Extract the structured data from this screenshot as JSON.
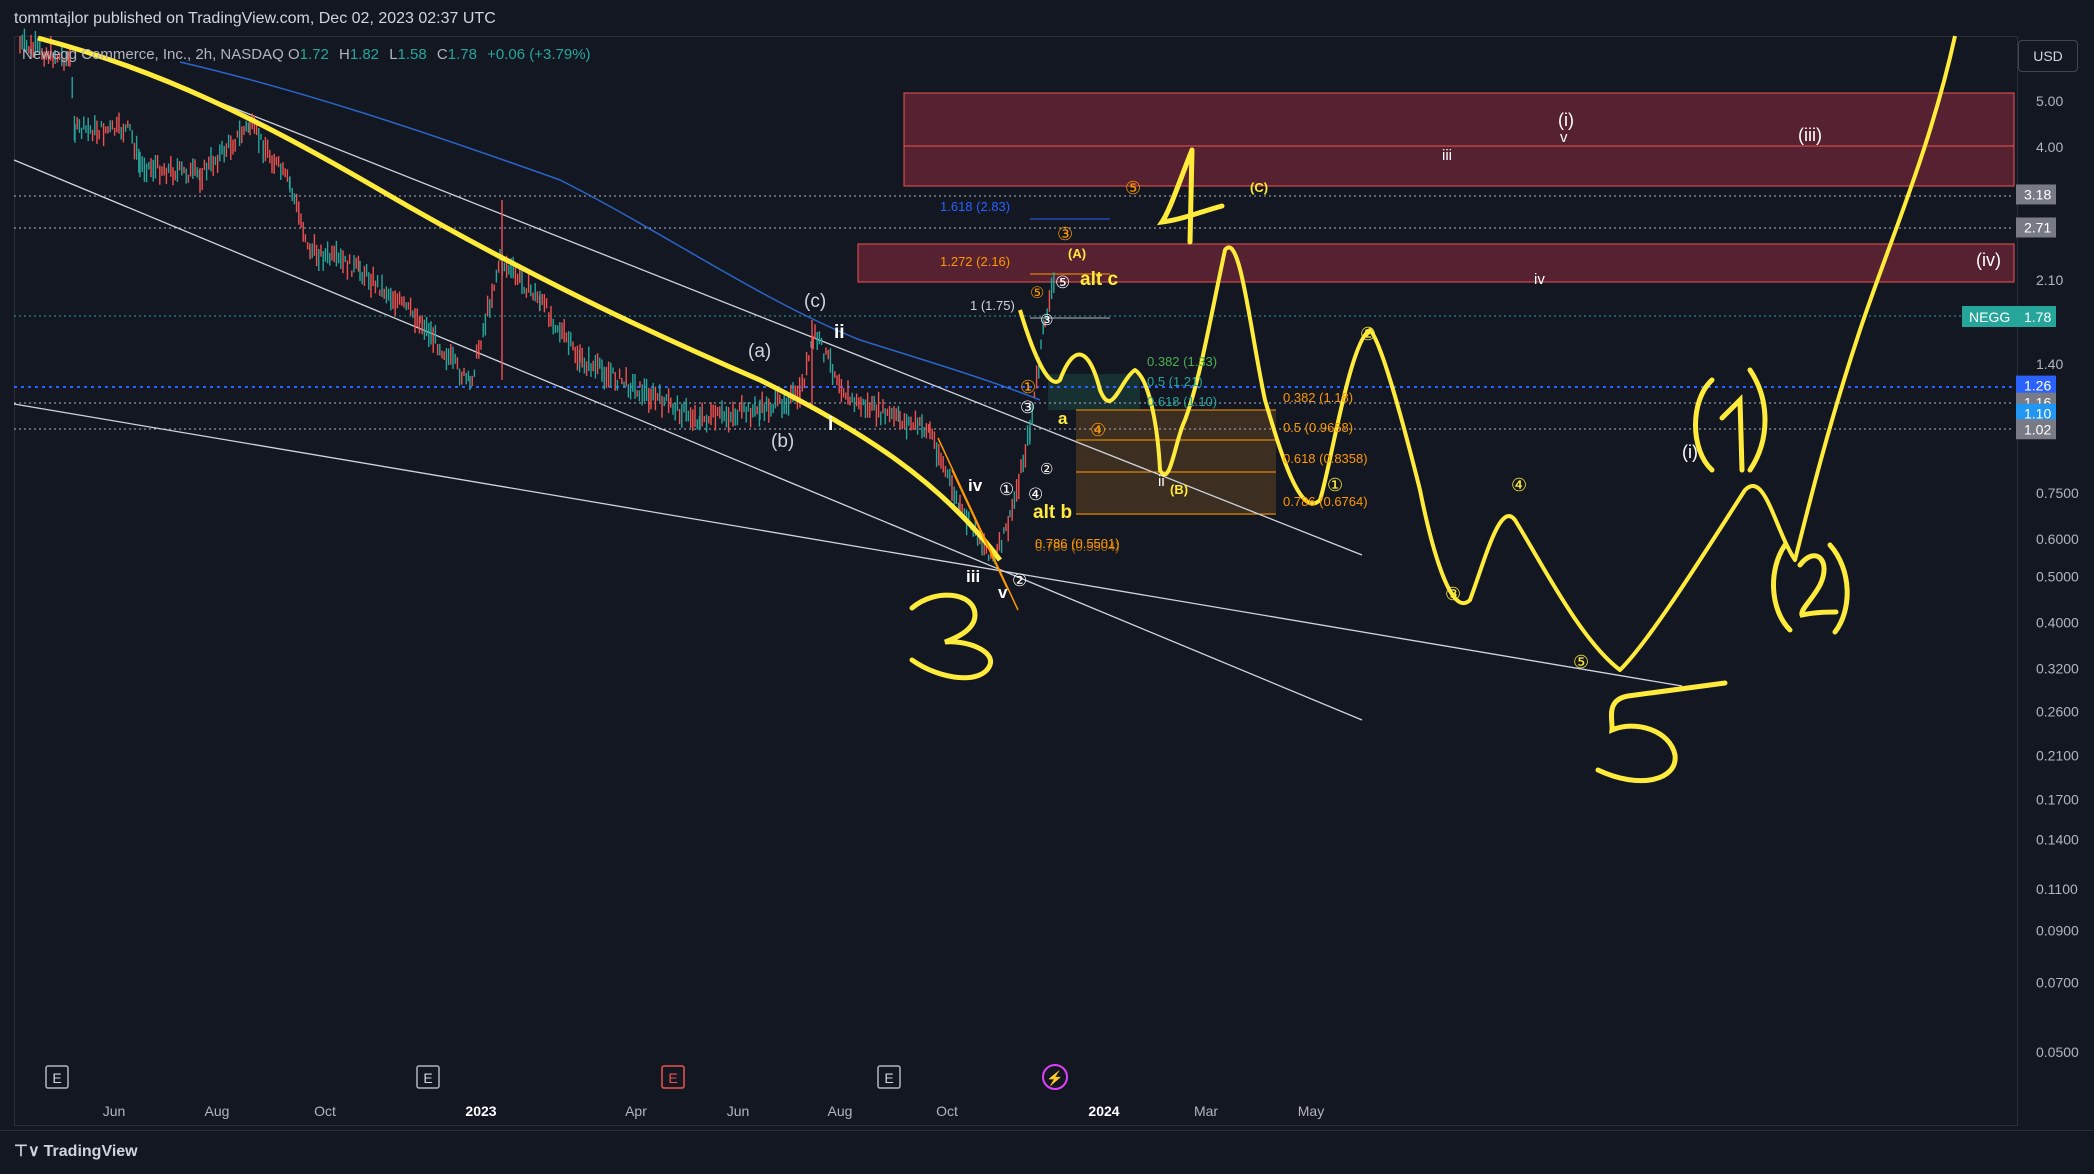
{
  "header": {
    "published_by": "tommtajlor published on TradingView.com, Dec 02, 2023 02:37 UTC"
  },
  "legend": {
    "symbol": "Newegg Commerce, Inc., 2h, NASDAQ",
    "open_label": "O",
    "open": "1.72",
    "high_label": "H",
    "high": "1.82",
    "low_label": "L",
    "low": "1.58",
    "close_label": "C",
    "close": "1.78",
    "change": "+0.06 (+3.79%)"
  },
  "currency": "USD",
  "footer": {
    "brand": "TradingView"
  },
  "colors": {
    "background": "#131722",
    "up": "#26a69a",
    "down": "#ef5350",
    "drawing": "#ffeb3b",
    "zone": "#8e2a3e",
    "blue_line": "#2962ff",
    "ma": "#3179f5"
  },
  "chart_data": {
    "type": "line",
    "title": "Newegg Commerce, Inc., 2h, NASDAQ",
    "y_scale": "log",
    "ylim": [
      0.045,
      6.0
    ],
    "x_ticks": [
      "Jun",
      "Aug",
      "Oct",
      "2023",
      "Apr",
      "Jun",
      "Aug",
      "Oct",
      "2024",
      "Mar",
      "May"
    ],
    "y_ticks": [
      "5.00",
      "4.00",
      "2.10",
      "1.40",
      "0.7500",
      "0.6000",
      "0.5000",
      "0.4000",
      "0.3200",
      "0.2600",
      "0.2100",
      "0.1700",
      "0.1400",
      "0.1100",
      "0.0900",
      "0.0700",
      "0.0500"
    ],
    "price_badges": [
      {
        "label": "3.18",
        "value": 3.18,
        "color": "#787b86"
      },
      {
        "label": "2.71",
        "value": 2.71,
        "color": "#787b86"
      },
      {
        "label": "1.26",
        "value": 1.26,
        "color": "#2962ff"
      },
      {
        "label": "1.16",
        "value": 1.16,
        "color": "#787b86"
      },
      {
        "label": "1.10",
        "value": 1.1,
        "color": "#2196f3"
      },
      {
        "label": "1.02",
        "value": 1.02,
        "color": "#787b86"
      }
    ],
    "last_price": {
      "symbol": "NEGG",
      "value": 1.78,
      "label": "1.78"
    },
    "event_markers": [
      "E",
      "E",
      "E",
      "E",
      "⚡"
    ],
    "fib_levels": [
      {
        "label": "1.618 (2.83)",
        "color": "#2962ff"
      },
      {
        "label": "1.272 (2.16)",
        "color": "#ff9800"
      },
      {
        "label": "1 (1.75)",
        "color": "#b2b5be"
      },
      {
        "label": "0.382 (1.33)",
        "color": "#4caf50"
      },
      {
        "label": "0.5 (1.21)",
        "color": "#26a69a"
      },
      {
        "label": "0.618 (1.10)",
        "color": "#26a69a"
      },
      {
        "label": "0.382 (1.18)",
        "color": "#ff9800"
      },
      {
        "label": "0.5 (0.9658)",
        "color": "#ff9800"
      },
      {
        "label": "0.618 (0.8358)",
        "color": "#ff9800"
      },
      {
        "label": "0.786 (0.6764)",
        "color": "#ff9800"
      },
      {
        "label": "0.786 (0.5501)",
        "color": "#ff9800"
      },
      {
        "label": "0.786 (0.5504)",
        "color": "#ff9800"
      }
    ],
    "wave_labels_white": [
      "(a)",
      "(b)",
      "(c)",
      "i",
      "ii",
      "iii",
      "iv",
      "v",
      "ii",
      "iii",
      "iv",
      "(i)",
      "(iii)",
      "(iv)",
      "(i)",
      "v"
    ],
    "wave_labels_yellow": [
      "alt c",
      "alt b",
      "a",
      "(A)",
      "(B)",
      "(C)"
    ],
    "circled_labels_orange": [
      "⑤",
      "③",
      "①",
      "④",
      "⑤"
    ],
    "circled_labels_yellow": [
      "②",
      "①",
      "④",
      "③",
      "⑤"
    ],
    "circled_labels_white": [
      "①",
      "②",
      "③",
      "④",
      "⑤",
      "②",
      "③"
    ],
    "handwritten_numbers": [
      "3",
      "4",
      "5",
      "(1)",
      "(2)"
    ]
  }
}
